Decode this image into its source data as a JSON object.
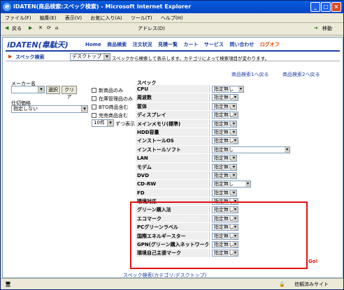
{
  "window": {
    "title": "iDATEN(商品検索:スペック検索) - Microsoft Internet Explorer"
  },
  "menu": [
    "ファイル(F)",
    "編集(E)",
    "表示(V)",
    "お気に入り(A)",
    "ツール(T)",
    "ヘルプ(H)"
  ],
  "toolbar": {
    "back": "戻る",
    "address_label": "アドレス(D)",
    "go": "移動"
  },
  "site": {
    "logo": "iDATEN(韋駄天)",
    "nav": {
      "home": "Home",
      "products": "商品検索",
      "orders": "注文状況",
      "quotes": "見積一覧",
      "cart": "カート",
      "services": "サービス",
      "inquiry": "問い合わせ",
      "logout": "ログオフ"
    }
  },
  "spec_search": {
    "title": "スペック検索",
    "category_value": "デスクトップ",
    "description": "スペックから検索して表示します。カテゴリによって検索項目が変わります。",
    "link1": "商品検索1へ戻る",
    "link2": "商品検索2へ戻る"
  },
  "left": {
    "maker_label": "メーカー名",
    "select_btn": "選択",
    "clear_btn": "クリア",
    "price_label": "仕切価格",
    "price_value": "指定しない",
    "checks": [
      "新商品のみ",
      "在庫管理品のみ",
      "BTO商品含む",
      "完売商品含む"
    ],
    "per_page_value": "10件",
    "per_page_suffix": "ずつ表示"
  },
  "spec_header": "スペック",
  "spec_rows": [
    {
      "name": "CPU",
      "value": "指定無し"
    },
    {
      "name": "周波数",
      "value": "指定無し"
    },
    {
      "name": "筐体",
      "value": "指定無し"
    },
    {
      "name": "ディスプレイ",
      "value": "指定無し"
    },
    {
      "name": "メインメモリ(標準)",
      "value": "指定無し"
    },
    {
      "name": "HDD容量",
      "value": "指定無し"
    },
    {
      "name": "インストールOS",
      "value": "指定無し"
    },
    {
      "name": "インストールソフト",
      "value": "指定無し"
    },
    {
      "name": "LAN",
      "value": "指定無し"
    },
    {
      "name": "モデム",
      "value": "指定無し"
    },
    {
      "name": "DVD",
      "value": "指定無し"
    },
    {
      "name": "CD-RW",
      "value": "指定無し"
    },
    {
      "name": "FD",
      "value": "指定無し"
    },
    {
      "name": "環境対応",
      "value": "指定無し"
    },
    {
      "name": "グリーン購入法",
      "value": "指定無し"
    },
    {
      "name": "エコマーク",
      "value": "指定無し"
    },
    {
      "name": "PCグリーンラベル",
      "value": "指定無し"
    },
    {
      "name": "国際エネルギースター",
      "value": "指定無し"
    },
    {
      "name": "GPN(グリーン購入ネットワーク)",
      "value": "指定無し"
    },
    {
      "name": "環境自己主張マーク",
      "value": "指定無し"
    }
  ],
  "go_label": "Go!",
  "footer_link": "スペック検索(カテゴリ:デスクトップ)",
  "status": {
    "zone": "信頼済みサイト"
  }
}
